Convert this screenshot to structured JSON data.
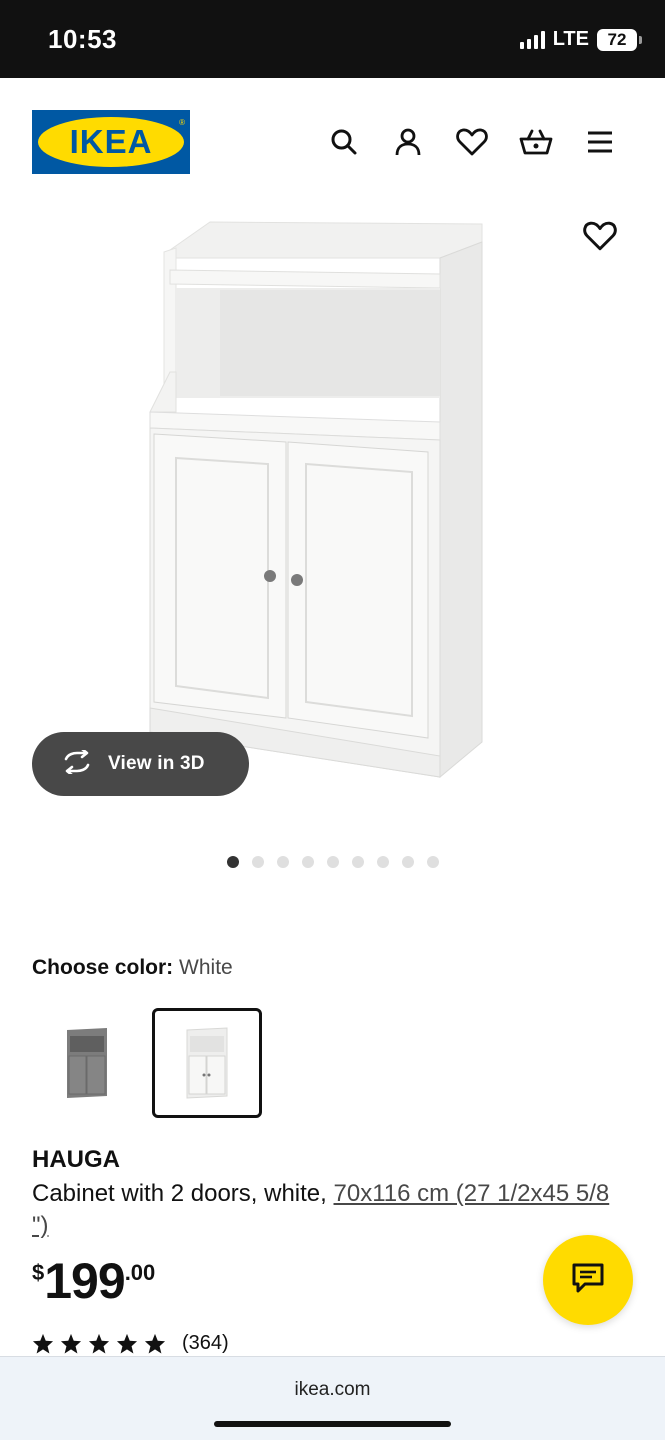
{
  "status": {
    "time": "10:53",
    "network": "LTE",
    "battery": "72"
  },
  "header": {
    "logo": "IKEA",
    "icons": [
      "search-icon",
      "account-icon",
      "heart-icon",
      "basket-icon",
      "menu-icon"
    ]
  },
  "hero": {
    "view3d_label": "View in 3D",
    "image_count": 9,
    "active_image": 1
  },
  "color": {
    "label": "Choose color:",
    "value": "White"
  },
  "product": {
    "name": "HAUGA",
    "description": "Cabinet with 2 doors, white,",
    "dimensions": "70x116 cm (27 1/2x45 5/8 \")",
    "price_currency": "$",
    "price_integer": "199",
    "price_decimal": ".00",
    "rating_stars": 5,
    "review_count": "(364)"
  },
  "browser": {
    "url": "ikea.com"
  },
  "colors": {
    "ikea_blue": "#0058a3",
    "ikea_yellow": "#ffdb00",
    "dark_pill": "#484848"
  }
}
